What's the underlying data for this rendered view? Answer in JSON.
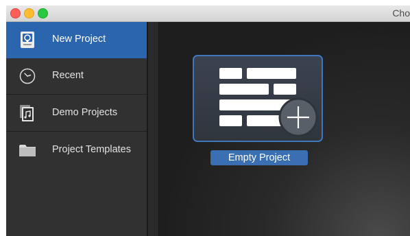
{
  "window": {
    "title": "Cho"
  },
  "sidebar": {
    "items": [
      {
        "label": "New Project",
        "icon": "new-project-icon",
        "selected": true
      },
      {
        "label": "Recent",
        "icon": "clock-icon",
        "selected": false
      },
      {
        "label": "Demo Projects",
        "icon": "music-document-icon",
        "selected": false
      },
      {
        "label": "Project Templates",
        "icon": "folder-icon",
        "selected": false
      }
    ]
  },
  "main": {
    "templates": [
      {
        "label": "Empty Project",
        "icon": "empty-project-icon",
        "selected": true
      }
    ]
  },
  "colors": {
    "selection": "#2b65ad",
    "sidebar_bg": "#313131",
    "content_bg": "#262626"
  }
}
